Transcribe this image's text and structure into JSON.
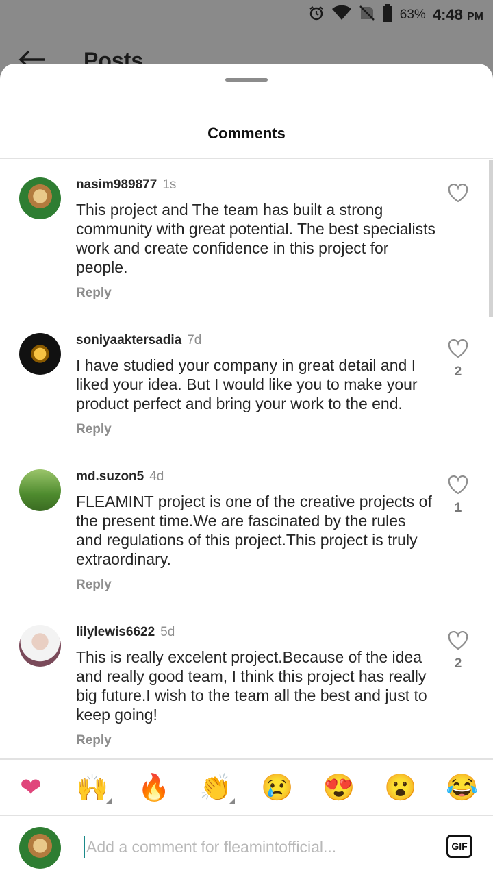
{
  "status": {
    "battery": "63%",
    "time": "4:48",
    "ampm": "PM"
  },
  "background_screen": {
    "title": "Posts"
  },
  "sheet": {
    "title": "Comments"
  },
  "comments": [
    {
      "username": "nasim989877",
      "time": "1s",
      "text": "This project and The team has built a strong community with great potential. The best specialists work and create confidence in this project for people.",
      "reply_label": "Reply",
      "likes": ""
    },
    {
      "username": "soniyaaktersadia",
      "time": "7d",
      "text": "I have studied your company in great detail and I liked your idea. But I would like you to make your product perfect and bring your work to the end.",
      "reply_label": "Reply",
      "likes": "2"
    },
    {
      "username": "md.suzon5",
      "time": "4d",
      "text": "FLEAMINT project is one of the creative projects of the present time.We are fascinated by the rules and regulations of this project.This project is truly extraordinary.",
      "reply_label": "Reply",
      "likes": "1"
    },
    {
      "username": "lilylewis6622",
      "time": "5d",
      "text": "This is really excelent project.Because of the idea and really good team, I think this project has really big future.I wish to the team all the best and just to keep going!",
      "reply_label": "Reply",
      "likes": "2"
    }
  ],
  "reactions": [
    "❤",
    "🙌",
    "🔥",
    "👏",
    "😢",
    "😍",
    "😮",
    "😂"
  ],
  "composer": {
    "placeholder": "Add a comment for fleamintofficial...",
    "gif_label": "GIF"
  }
}
